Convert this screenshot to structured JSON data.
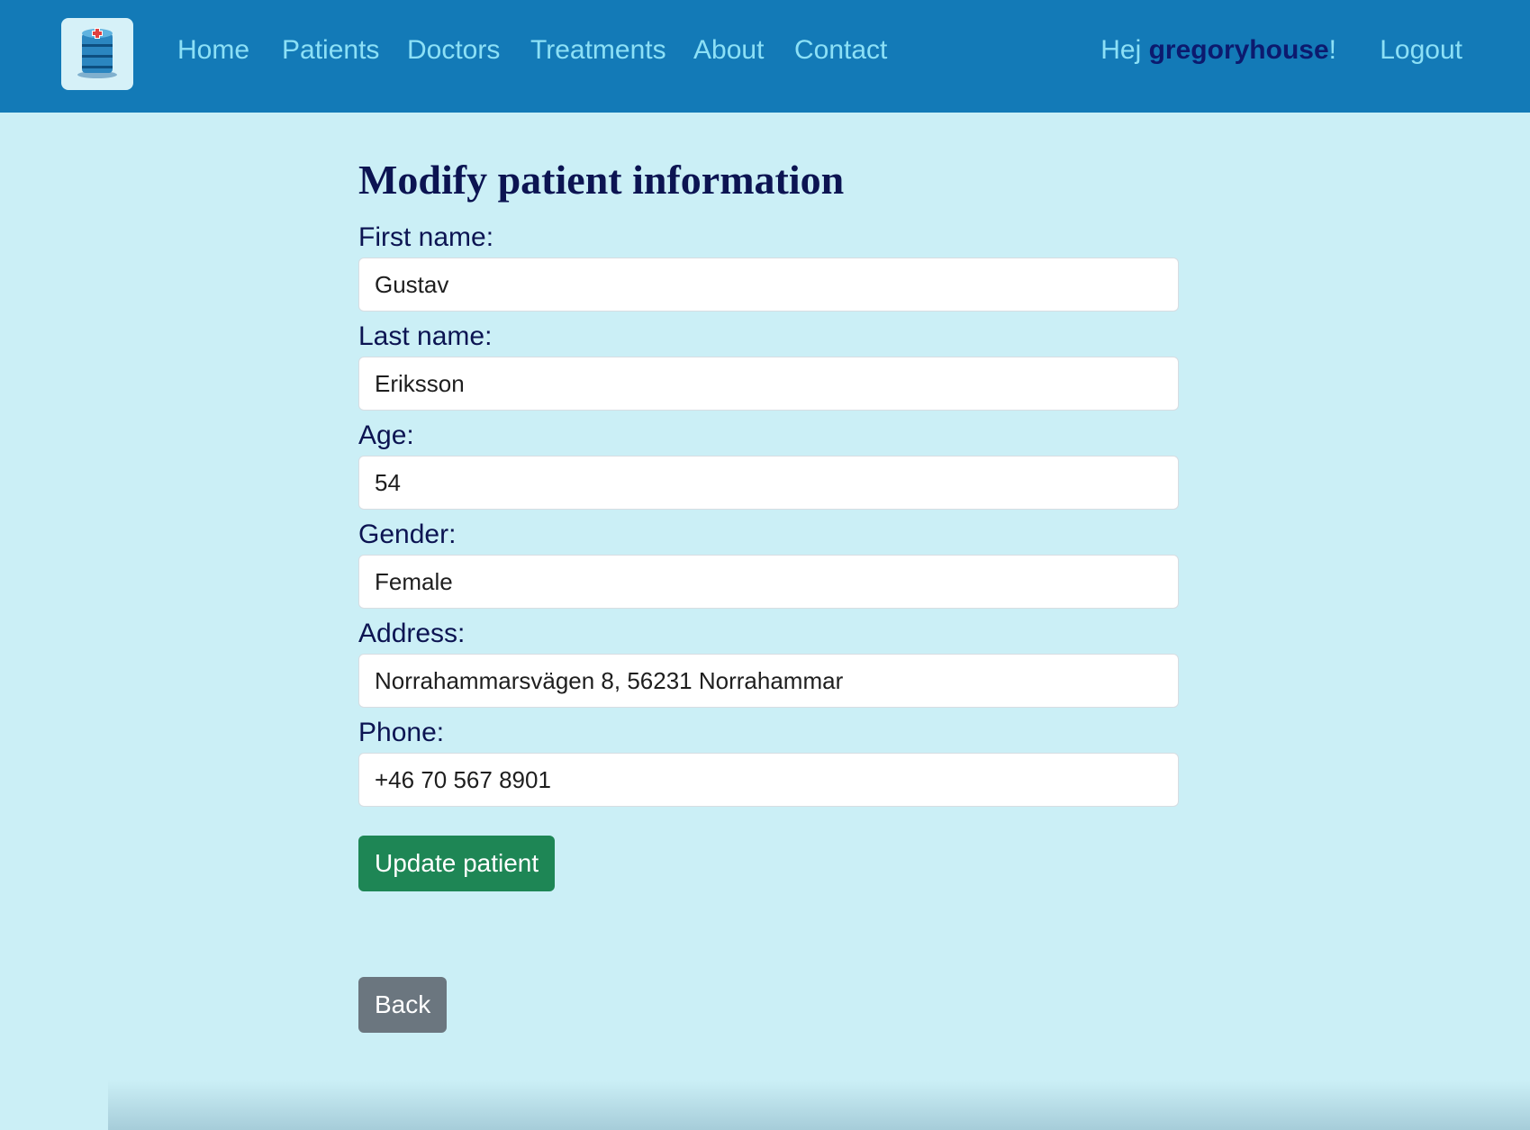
{
  "nav": {
    "logo_icon": "hospital-database-icon",
    "links": [
      "Home",
      "Patients",
      "Doctors",
      "Treatments",
      "About",
      "Contact"
    ],
    "greeting_prefix": "Hej ",
    "username": "gregoryhouse",
    "greeting_suffix": "!",
    "logout": "Logout"
  },
  "page": {
    "title": "Modify patient information"
  },
  "form": {
    "first_name_label": "First name:",
    "first_name": "Gustav",
    "last_name_label": "Last name:",
    "last_name": "Eriksson",
    "age_label": "Age:",
    "age": "54",
    "gender_label": "Gender:",
    "gender": "Female",
    "address_label": "Address:",
    "address": "Norrahammarsvägen 8, 56231 Norrahammar",
    "phone_label": "Phone:",
    "phone": "+46 70 567 8901",
    "submit_label": "Update patient"
  },
  "back_label": "Back",
  "colors": {
    "navbar": "#137ab7",
    "background": "#cbeff6",
    "nav_link": "#8ce0f6",
    "heading": "#0c1452",
    "update_button": "#1e8655",
    "back_button": "#6b767f"
  }
}
